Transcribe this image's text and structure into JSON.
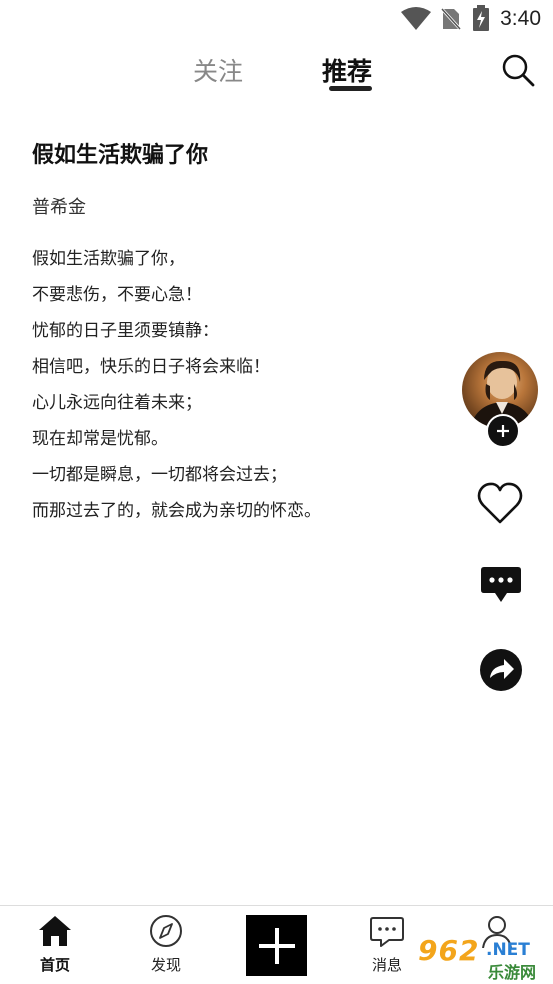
{
  "status_bar": {
    "time": "3:40",
    "icons": [
      "wifi-icon",
      "no-sim-icon",
      "battery-charging-icon"
    ]
  },
  "top_tabs": {
    "follow": "关注",
    "recommend": "推荐",
    "active": "recommend",
    "search_icon": "search-icon"
  },
  "poem": {
    "title": "假如生活欺骗了你",
    "author": "普希金",
    "lines": [
      "假如生活欺骗了你，",
      "不要悲伤，不要心急！",
      "忧郁的日子里须要镇静：",
      "相信吧，快乐的日子将会来临！",
      "心儿永远向往着未来；",
      "现在却常是忧郁。",
      "一切都是瞬息，一切都将会过去；",
      "而那过去了的，就会成为亲切的怀恋。"
    ]
  },
  "actions": {
    "icons": [
      "avatar",
      "follow-plus-icon",
      "heart-icon",
      "comment-icon",
      "share-icon"
    ]
  },
  "bottom_nav": {
    "home": "首页",
    "discover": "发现",
    "messages": "消息",
    "active": "home",
    "icons": [
      "home-icon",
      "compass-icon",
      "add-icon",
      "message-icon",
      "profile-icon"
    ]
  },
  "watermark": {
    "logo": "962",
    "domain": ".NET",
    "name": "乐游网"
  },
  "colors": {
    "text": "#111111",
    "inactive_tab": "#888888",
    "accent": "#000000",
    "watermark_orange": "#f3a51b"
  }
}
